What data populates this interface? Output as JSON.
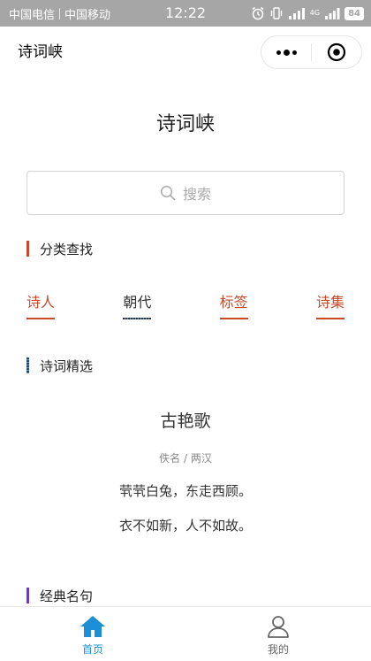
{
  "status": {
    "carrier1": "中国电信",
    "carrier2": "中国移动",
    "time": "12:22",
    "network": "4G",
    "battery": "84"
  },
  "nav": {
    "title": "诗词峡"
  },
  "main": {
    "title": "诗词峡",
    "search_placeholder": "搜索"
  },
  "sections": {
    "category": "分类查找",
    "featured": "诗词精选",
    "quotes": "经典名句"
  },
  "categories": [
    {
      "label": "诗人",
      "color": "#c8492a",
      "line": "#c8492a"
    },
    {
      "label": "朝代",
      "color": "#333333",
      "line": "#2b3a4a"
    },
    {
      "label": "标签",
      "color": "#c8492a",
      "line": "#c8492a"
    },
    {
      "label": "诗集",
      "color": "#c8492a",
      "line": "#c8492a"
    }
  ],
  "poem": {
    "title": "古艳歌",
    "author": "佚名 / 两汉",
    "lines": [
      "茕茕白兔，东走西顾。",
      "衣不如新，人不如故。"
    ]
  },
  "tabs": [
    {
      "label": "首页",
      "icon": "home-icon",
      "active": true
    },
    {
      "label": "我的",
      "icon": "user-icon",
      "active": false
    }
  ],
  "colors": {
    "accent": "#c8492a",
    "tab_active": "#1d8fd8",
    "tab_inactive": "#666666",
    "statusbar": "#a6a6a6",
    "section_category": "#c8492a",
    "section_featured": "#2c4a6e",
    "section_quotes": "#6a3fb5"
  }
}
